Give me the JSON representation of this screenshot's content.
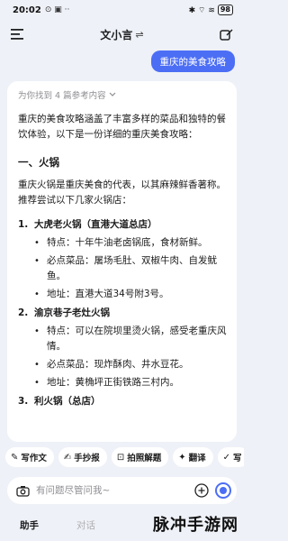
{
  "status_bar": {
    "time": "20:02",
    "mini_icons": "⊙ ▣ ··",
    "right_icons": "✱ ⌔ ≋",
    "battery": "98"
  },
  "nav": {
    "title": "文小言",
    "swap_glyph": "⇌"
  },
  "user_message": "重庆的美食攻略",
  "answer": {
    "refs_label": "为你找到 4 篇参考内容",
    "intro": "重庆的美食攻略涵盖了丰富多样的菜品和独特的餐饮体验，以下是一份详细的重庆美食攻略：",
    "section_title": "一、火锅",
    "section_desc": "重庆火锅是重庆美食的代表，以其麻辣鲜香著称。推荐尝试以下几家火锅店：",
    "shops": [
      {
        "num": "1.",
        "name": "大虎老火锅（直港大道总店）",
        "bullets": [
          "特点：十年牛油老卤锅底，食材新鲜。",
          "必点菜品：屠场毛肚、双椒牛肉、自发鱿鱼。",
          "地址：直港大道34号附3号。"
        ]
      },
      {
        "num": "2.",
        "name": "渝京巷子老灶火锅",
        "bullets": [
          "特点：可以在院坝里烫火锅，感受老重庆风情。",
          "必点菜品：现炸酥肉、井水豆花。",
          "地址：黄桷坪正街铁路三村内。"
        ]
      },
      {
        "num": "3.",
        "name": "利火锅（总店）",
        "bullets": []
      }
    ]
  },
  "quick_actions": [
    {
      "icon": "✎",
      "label": "写作文"
    },
    {
      "icon": "✍",
      "label": "手抄报"
    },
    {
      "icon": "⊡",
      "label": "拍照解题"
    },
    {
      "icon": "✦",
      "label": "翻译"
    },
    {
      "icon": "✓",
      "label": "写"
    }
  ],
  "input": {
    "placeholder": "有问题尽管问我~"
  },
  "tabs": {
    "assistant": "助手",
    "chat": "对话"
  },
  "watermark": "脉冲手游网",
  "colors": {
    "accent": "#4c6ef5",
    "background": "#eef1f7"
  }
}
